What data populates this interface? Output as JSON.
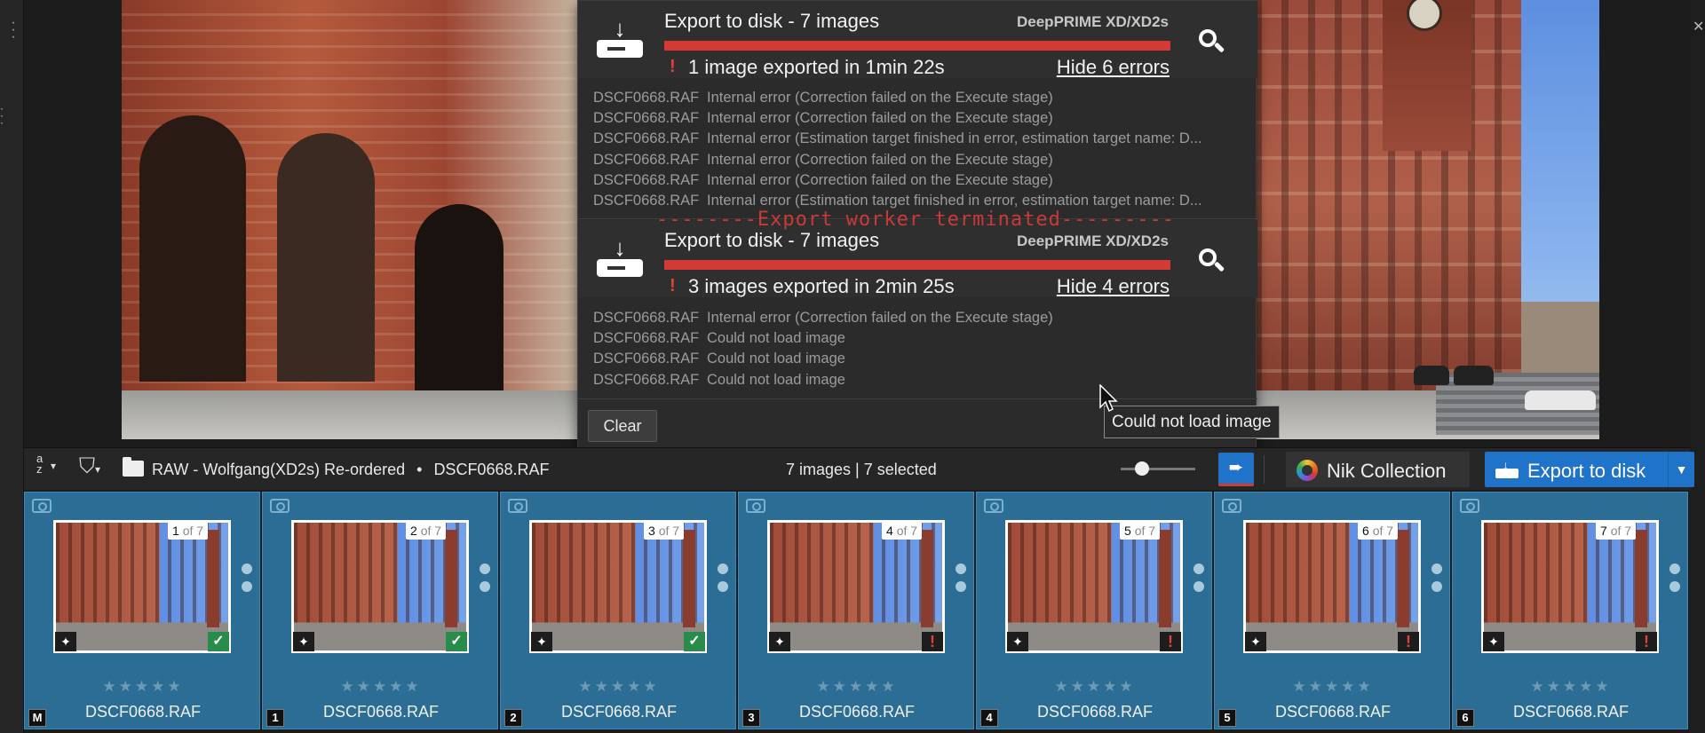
{
  "panel": {
    "jobs": [
      {
        "title": "Export to disk - 7 images",
        "engine": "DeepPRIME XD/XD2s",
        "status": "1 image exported in 1min 22s",
        "hide_label": "Hide 6 errors",
        "errors": [
          {
            "file": "DSCF0668.RAF",
            "message": "Internal error (Correction failed on the Execute stage)"
          },
          {
            "file": "DSCF0668.RAF",
            "message": "Internal error (Correction failed on the Execute stage)"
          },
          {
            "file": "DSCF0668.RAF",
            "message": "Internal error (Estimation target finished in error, estimation target name: D..."
          },
          {
            "file": "DSCF0668.RAF",
            "message": "Internal error (Correction failed on the Execute stage)"
          },
          {
            "file": "DSCF0668.RAF",
            "message": "Internal error (Correction failed on the Execute stage)"
          },
          {
            "file": "DSCF0668.RAF",
            "message": "Internal error (Estimation target finished in error, estimation target name: D..."
          }
        ]
      },
      {
        "title": "Export to disk - 7 images",
        "engine": "DeepPRIME XD/XD2s",
        "status": "3 images exported in 2min 25s",
        "hide_label": "Hide 4 errors",
        "errors": [
          {
            "file": "DSCF0668.RAF",
            "message": "Internal error (Correction failed on the Execute stage)"
          },
          {
            "file": "DSCF0668.RAF",
            "message": "Could not load image"
          },
          {
            "file": "DSCF0668.RAF",
            "message": "Could not load image"
          },
          {
            "file": "DSCF0668.RAF",
            "message": "Could not load image"
          }
        ]
      }
    ],
    "terminated_banner": "--------Export worker terminated---------",
    "clear_label": "Clear",
    "tooltip": "Could not load image",
    "error_color": "#d33a34"
  },
  "toolbar": {
    "sort_label": "a\nz",
    "path_folder": "RAW - Wolfgang(XD2s) Re-ordered",
    "path_sep": "•",
    "path_file": "DSCF0668.RAF",
    "count": "7 images | 7 selected",
    "nik_label": "Nik Collection",
    "export_label": "Export to disk",
    "accent": "#1f73c8"
  },
  "filmstrip": {
    "total_label": "of 7",
    "items": [
      {
        "index": "1",
        "badge": "M",
        "name": "DSCF0668.RAF",
        "state": "ok"
      },
      {
        "index": "2",
        "badge": "1",
        "name": "DSCF0668.RAF",
        "state": "ok"
      },
      {
        "index": "3",
        "badge": "2",
        "name": "DSCF0668.RAF",
        "state": "ok"
      },
      {
        "index": "4",
        "badge": "3",
        "name": "DSCF0668.RAF",
        "state": "error"
      },
      {
        "index": "5",
        "badge": "4",
        "name": "DSCF0668.RAF",
        "state": "error"
      },
      {
        "index": "6",
        "badge": "5",
        "name": "DSCF0668.RAF",
        "state": "error"
      },
      {
        "index": "7",
        "badge": "6",
        "name": "DSCF0668.RAF",
        "state": "error"
      }
    ]
  }
}
